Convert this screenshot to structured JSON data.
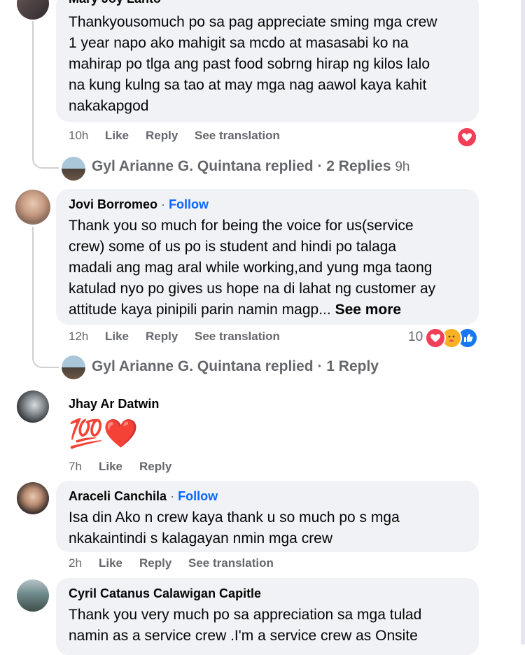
{
  "comments": [
    {
      "name": "Mary Joy Lanto",
      "text": "Thankyousomuch po sa pag appreciate sming mga crew\n1 year napo ako mahigit sa mcdo at masasabi ko na\nmahirap po tlga ang past food sobrng hirap ng kilos lalo\nna kung kulng sa tao at may mga nag aawol kaya kahit\nnakakapgod",
      "time": "10h",
      "like": "Like",
      "reply": "Reply",
      "translate": "See translation",
      "replies_line": "Gyl Arianne G. Quintana replied · 2 Replies",
      "replies_time": "9h"
    },
    {
      "name": "Jovi Borromeo",
      "follow": "Follow",
      "separator": "·",
      "text": "Thank you so much for being the voice for us(service\ncrew) some of us po is student and hindi po talaga\nmadali ang mag aral while working,and yung mga taong\nkatulad nyo po gives us hope na di lahat ng customer ay\nattitude kaya pinipili parin namin magp...",
      "see_more": "See more",
      "time": "12h",
      "like": "Like",
      "reply": "Reply",
      "translate": "See translation",
      "reaction_count": "10",
      "replies_line": "Gyl Arianne G. Quintana replied · 1 Reply"
    },
    {
      "name": "Jhay Ar Datwin",
      "emoji": "💯❤️",
      "time": "7h",
      "like": "Like",
      "reply": "Reply"
    },
    {
      "name": "Araceli Canchila",
      "follow": "Follow",
      "separator": "·",
      "text": "Isa din Ako n crew kaya thank u so much po s mga\nnkakaintindi s kalagayan nmin mga crew",
      "time": "2h",
      "like": "Like",
      "reply": "Reply",
      "translate": "See translation"
    },
    {
      "name": "Cyril Catanus Calawigan Capitle",
      "text": "Thank you very much po sa appreciation sa mga tulad\nnamin as a service crew .I'm a service crew as Onsite"
    }
  ],
  "colors": {
    "bubble": "#f0f2f5",
    "secondary_text": "#65676b",
    "link": "#0866ff",
    "love": "#f33e58",
    "like": "#1877f2"
  }
}
